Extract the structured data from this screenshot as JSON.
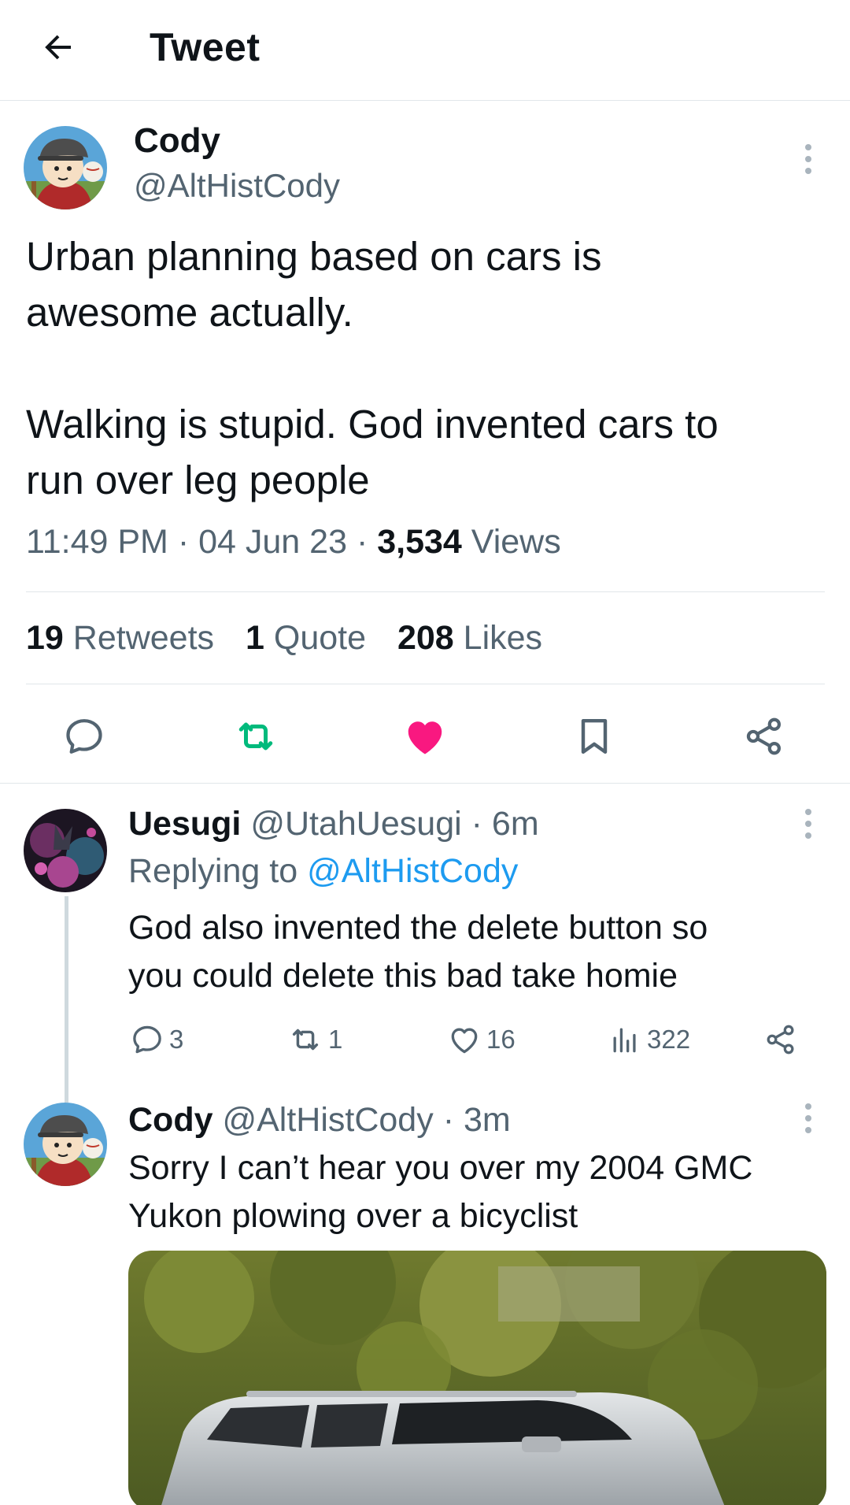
{
  "header": {
    "title": "Tweet",
    "back_icon": "arrow-left-icon"
  },
  "main_tweet": {
    "author_name": "Cody",
    "author_handle": "@AltHistCody",
    "text_line_1": "Urban planning based on cars is",
    "text_line_2": "awesome actually.",
    "text_line_3": "Walking is stupid. God invented cars to",
    "text_line_4": "run over leg people",
    "time": "11:49 PM",
    "date": "04 Jun 23",
    "separator": "·",
    "views_count": "3,534",
    "views_label": "Views",
    "retweets_count": "19",
    "retweets_label": "Retweets",
    "quotes_count": "1",
    "quotes_label": "Quote",
    "likes_count": "208",
    "likes_label": "Likes",
    "liked": true,
    "colors": {
      "like_active": "#f91880",
      "retweet_active": "#00ba7c",
      "text_secondary": "#536471",
      "link": "#1d9bf0"
    }
  },
  "replies": [
    {
      "author_name": "Uesugi",
      "author_handle": "@UtahUesugi",
      "age": "6m",
      "replying_label": "Replying to",
      "replying_to": "@AltHistCody",
      "text_line_1": "God also invented the delete button so",
      "text_line_2": "you could delete this bad take homie",
      "reply_count": "3",
      "retweet_count": "1",
      "like_count": "16",
      "view_count": "322"
    },
    {
      "author_name": "Cody",
      "author_handle": "@AltHistCody",
      "age": "3m",
      "text_line_1": "Sorry I can’t hear you over my 2004 GMC",
      "text_line_2": "Yukon plowing over a bicyclist"
    }
  ]
}
